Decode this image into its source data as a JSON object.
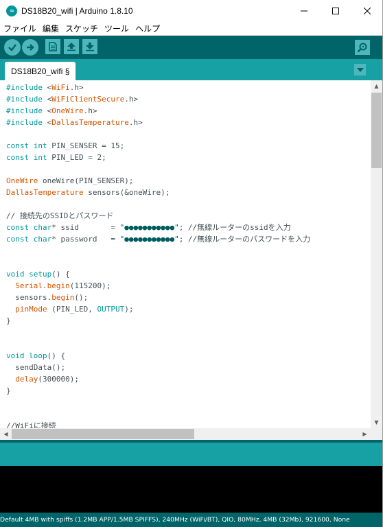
{
  "window": {
    "title": "DS18B20_wifi | Arduino 1.8.10",
    "icon": "arduino-logo-icon",
    "controls": [
      "minimize-icon",
      "maximize-icon",
      "close-icon"
    ]
  },
  "menu": {
    "items": [
      "ファイル",
      "編集",
      "スケッチ",
      "ツール",
      "ヘルプ"
    ]
  },
  "toolbar": {
    "buttons": [
      "verify-icon",
      "upload-icon",
      "new-icon",
      "open-icon",
      "save-icon"
    ],
    "serial_monitor": "serial-monitor-icon"
  },
  "tabs": {
    "active": "DS18B20_wifi §",
    "menu_icon": "tab-menu-icon"
  },
  "code": {
    "lines": [
      "#include <WiFi.h>",
      "#include <WiFiClientSecure.h>",
      "#include <OneWire.h>",
      "#include <DallasTemperature.h>",
      "",
      "const int PIN_SENSER = 15;",
      "const int PIN_LED = 2;",
      "",
      "OneWire oneWire(PIN_SENSER);",
      "DallasTemperature sensors(&oneWire);",
      "",
      "// 接続先のSSIDとパスワード",
      "const char* ssid       = \"●●●●●●●●●●●\"; //無線ルーターのssidを入力",
      "const char* password   = \"●●●●●●●●●●●\"; //無線ルーターのパスワードを入力",
      "",
      "",
      "void setup() {",
      "  Serial.begin(115200);",
      "  sensors.begin();",
      "  pinMode (PIN_LED, OUTPUT);",
      "}",
      "",
      "",
      "void loop() {",
      "  sendData();",
      "  delay(300000);",
      "}",
      "",
      "",
      "//WiFiに接続"
    ]
  },
  "status": {
    "board_info": "Default 4MB with spiffs (1.2MB APP/1.5MB SPIFFS), 240MHz (WiFi/BT), QIO, 80MHz, 4MB (32Mb), 921600, None"
  },
  "colors": {
    "toolbar": "#006468",
    "tabbar": "#17a1a5",
    "button": "#4db7bb",
    "keyword": "#00979c",
    "class": "#d35400",
    "console": "#000000"
  }
}
